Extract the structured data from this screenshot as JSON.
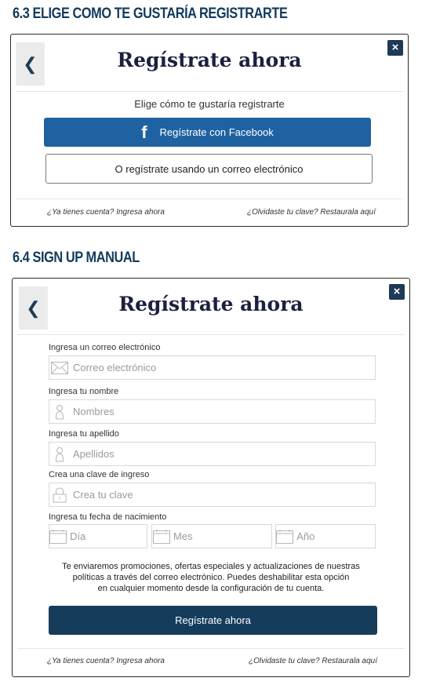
{
  "section1": {
    "heading": "6.3 ELIGE COMO TE GUSTARÍA REGISTRARTE",
    "modal": {
      "close_label": "×",
      "back_label": "❮",
      "title": "Regístrate ahora",
      "subtitle": "Elige cómo te gustaría registrarte",
      "facebook_icon": "f",
      "facebook_label": "Regístrate con Facebook",
      "email_label": "O regístrate usando un correo electrónico",
      "login_link": "¿Ya tienes cuenta? Ingresa ahora",
      "recover_link": "¿Olvidaste tu clave? Restaurala aquí"
    }
  },
  "section2": {
    "heading": "6.4 SIGN UP MANUAL",
    "modal": {
      "close_label": "×",
      "back_label": "❮",
      "title": "Regístrate ahora",
      "fields": {
        "email": {
          "label": "Ingresa un correo electrónico",
          "placeholder": "Correo electrónico",
          "icon": "envelope-icon"
        },
        "name": {
          "label": "Ingresa tu nombre",
          "placeholder": "Nombres",
          "icon": "user-icon"
        },
        "surname": {
          "label": "Ingresa tu apellido",
          "placeholder": "Apellidos",
          "icon": "user-icon"
        },
        "password": {
          "label": "Crea una clave de ingreso",
          "placeholder": "Crea tu clave",
          "icon": "lock-icon"
        },
        "birthdate": {
          "label": "Ingresa tu fecha de nacimiento",
          "day_placeholder": "Día",
          "month_placeholder": "Mes",
          "year_placeholder": "Año",
          "icon": "calendar-icon"
        }
      },
      "notice_lines": [
        "Te enviaremos promociones, ofertas especiales y actualizaciones de nuestras",
        "políticas a través del correo electrónico. Puedes deshabilitar esta opción",
        "en cualquier momento desde la configuración de tu cuenta."
      ],
      "submit_label": "Regístrate ahora",
      "login_link": "¿Ya tienes cuenta? Ingresa ahora",
      "recover_link": "¿Olvidaste tu clave? Restaurala aquí"
    }
  },
  "colors": {
    "heading": "#123a5e",
    "facebook": "#1f62a1",
    "submit": "#163c5c",
    "close": "#1d3a57"
  }
}
